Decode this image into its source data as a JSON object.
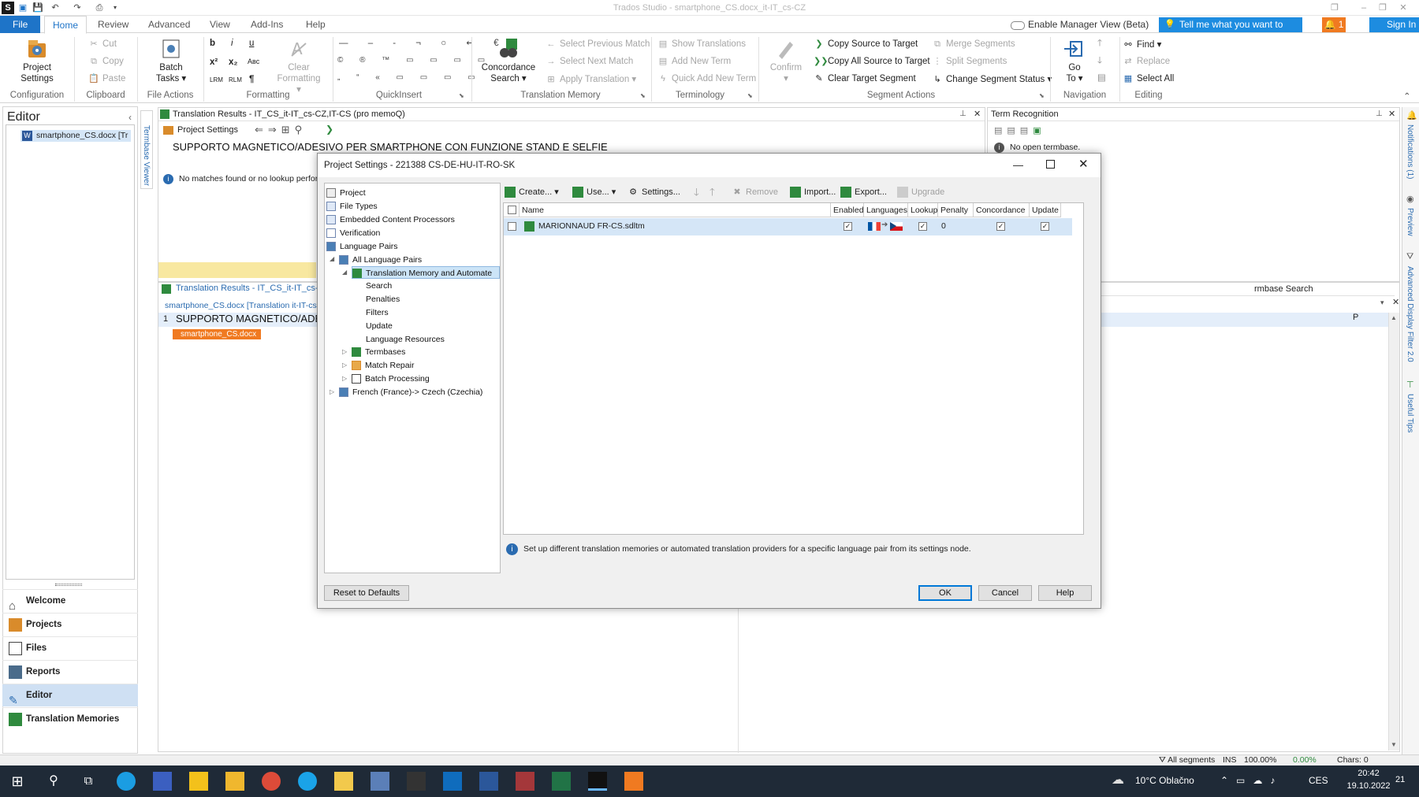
{
  "window": {
    "title": "Trados Studio - smartphone_CS.docx_it-IT_cs-CZ"
  },
  "menu": {
    "file": "File",
    "tabs": [
      "Home",
      "Review",
      "Advanced",
      "View",
      "Add-Ins",
      "Help"
    ],
    "manager_view": "Enable Manager View (Beta)",
    "tell_me": "Tell me what you want to do...",
    "notif_count": "1",
    "sign_in": "Sign In"
  },
  "ribbon": {
    "groups": [
      "Configuration",
      "Clipboard",
      "File Actions",
      "Formatting",
      "QuickInsert",
      "Translation Memory",
      "Terminology",
      "Segment Actions",
      "Navigation",
      "Editing"
    ],
    "project_settings": [
      "Project",
      "Settings"
    ],
    "cut": "Cut",
    "copy": "Copy",
    "paste": "Paste",
    "batch_tasks": [
      "Batch",
      "Tasks"
    ],
    "clear_formatting": [
      "Clear",
      "Formatting"
    ],
    "concordance": [
      "Concordance",
      "Search"
    ],
    "tm": [
      "Select Previous Match",
      "Select Next Match",
      "Apply Translation"
    ],
    "term": [
      "Show Translations",
      "Add New Term",
      "Quick Add New Term"
    ],
    "confirm": "Confirm",
    "seg": [
      "Copy Source to Target",
      "Copy All Source to Target",
      "Clear Target Segment"
    ],
    "seg2": [
      "Merge Segments",
      "Split Segments",
      "Change Segment Status"
    ],
    "goto": [
      "Go",
      "To"
    ],
    "edit": [
      "Find",
      "Replace",
      "Select All"
    ]
  },
  "editor": {
    "title": "Editor",
    "file": "smartphone_CS.docx [Tr",
    "side_label": "Termbase Viewer"
  },
  "nav": [
    "Welcome",
    "Projects",
    "Files",
    "Reports",
    "Editor",
    "Translation Memories"
  ],
  "translation_results": {
    "title": "Translation Results - IT_CS_it-IT_cs-CZ,IT-CS (pro memoQ)",
    "project_settings": "Project Settings",
    "source": "SUPPORTO MAGNETICO/ADESIVO PER SMARTPHONE CON FUNZIONE STAND E SELFIE",
    "no_matches": "No matches found or no lookup performe"
  },
  "term_recognition": {
    "title": "Term Recognition",
    "no_termbase": "No open termbase."
  },
  "lower": {
    "tab": "Translation Results - IT_CS_it-IT_cs-C",
    "file": "smartphone_CS.docx [Translation it-IT-cs",
    "seg_num": "1",
    "seg_text": "SUPPORTO MAGNETICO/ADES",
    "file_tag": "smartphone_CS.docx",
    "termbase_search": "rmbase Search",
    "p_col": "P"
  },
  "right_tabs": [
    "Notifications (1)",
    "Preview",
    "Advanced Display Filter 2.0",
    "Useful Tips"
  ],
  "dialog": {
    "title": "Project Settings - 221388 CS-DE-HU-IT-RO-SK",
    "tree": [
      "Project",
      "File Types",
      "Embedded Content Processors",
      "Verification",
      "Language Pairs",
      "All Language Pairs",
      "Translation Memory and Automate",
      "Search",
      "Penalties",
      "Filters",
      "Update",
      "Language Resources",
      "Termbases",
      "Match Repair",
      "Batch Processing",
      "French (France)-> Czech (Czechia)"
    ],
    "toolbar": [
      "Create...",
      "Use...",
      "Settings...",
      "Remove",
      "Import...",
      "Export...",
      "Upgrade"
    ],
    "columns": [
      "Name",
      "Enabled",
      "Languages",
      "Lookup",
      "Penalty",
      "Concordance",
      "Update"
    ],
    "rows": [
      {
        "name": "MARIONNAUD FR-CS.sdltm",
        "penalty": "0"
      }
    ],
    "info": "Set up different translation memories or automated translation providers for a specific language pair from its settings node.",
    "reset": "Reset to Defaults",
    "ok": "OK",
    "cancel": "Cancel",
    "help": "Help"
  },
  "status": {
    "segments": "All segments",
    "ins": "INS",
    "zoom": "100.00%",
    "pct": "0.00%",
    "chars": "Chars: 0"
  },
  "taskbar": {
    "weather": "10°C Oblačno",
    "lang": "CES",
    "time": "20:42",
    "date": "19.10.2022",
    "notif": "21"
  }
}
